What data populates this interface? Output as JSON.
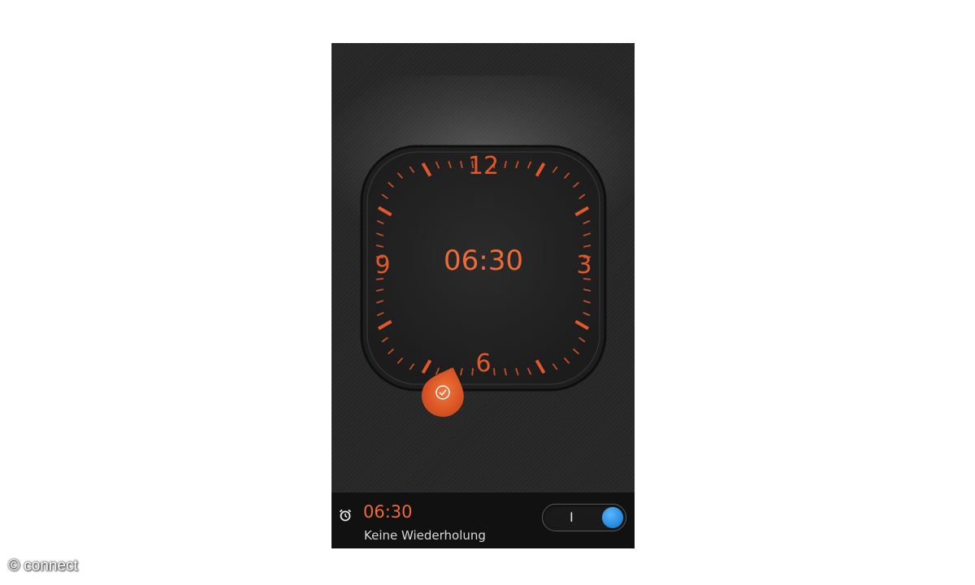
{
  "clock": {
    "time": "06:30",
    "numerals": {
      "twelve": "12",
      "three": "3",
      "six": "6",
      "nine": "9"
    }
  },
  "alarm": {
    "time": "06:30",
    "repeat": "Keine Wiederholung",
    "toggle_label": "I",
    "enabled": true
  },
  "watermark": "© connect",
  "colors": {
    "accent": "#f06a37",
    "toggle_on": "#2a8de0",
    "background": "#262626"
  },
  "icons": {
    "alarm": "alarm-clock-icon",
    "handle": "alarm-check-icon"
  }
}
